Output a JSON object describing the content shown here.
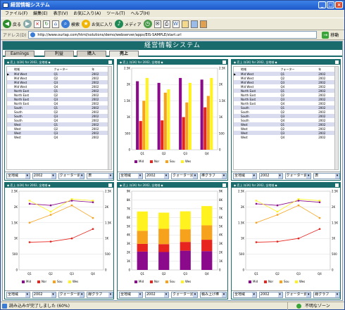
{
  "window": {
    "title": "経営情報システム"
  },
  "menu": [
    "ファイル(F)",
    "編集(E)",
    "表示(V)",
    "お気に入り(A)",
    "ツール(T)",
    "ヘルプ(H)"
  ],
  "toolbar": {
    "back": "戻る",
    "search": "検索",
    "favorites": "お気に入り",
    "media": "メディア"
  },
  "address": {
    "label": "アドレス(D)",
    "url": "http://www.ourlap.com/html/solutions/demo/webserver/apps/EIS-SAMPLE/start.url",
    "go": "移動"
  },
  "app": {
    "title": "経営情報システム",
    "tabs": [
      "Earnings",
      "利益",
      "購入",
      "売上"
    ],
    "active_tab": 3
  },
  "panel_header": "◆ 売上 ($1K) for 2002, 全地域 ◆",
  "table": {
    "columns": [
      "地域",
      "クォーター",
      "年"
    ],
    "rows": [
      [
        "Mid West",
        "Q1",
        "2002"
      ],
      [
        "Mid West",
        "Q2",
        "2002"
      ],
      [
        "Mid West",
        "Q3",
        "2002"
      ],
      [
        "Mid West",
        "Q4",
        "2002"
      ],
      [
        "North East",
        "Q1",
        "2002"
      ],
      [
        "North East",
        "Q2",
        "2002"
      ],
      [
        "North East",
        "Q3",
        "2002"
      ],
      [
        "North East",
        "Q4",
        "2002"
      ],
      [
        "South",
        "Q1",
        "2002"
      ],
      [
        "South",
        "Q2",
        "2002"
      ],
      [
        "South",
        "Q3",
        "2002"
      ],
      [
        "South",
        "Q4",
        "2002"
      ],
      [
        "West",
        "Q1",
        "2002"
      ],
      [
        "West",
        "Q2",
        "2002"
      ],
      [
        "West",
        "Q3",
        "2002"
      ],
      [
        "West",
        "Q4",
        "2002"
      ]
    ]
  },
  "controls": {
    "region": "全地域",
    "year": "2002",
    "quarter": "クォーター別",
    "view_table": "表",
    "view_bar": "棒グラフ",
    "view_line": "線グラフ",
    "view_stacked": "積み上げ棒"
  },
  "status": {
    "left": "読み込みが完了しました (60%)",
    "right": "不明なゾーン"
  },
  "colors": {
    "Mid": "#8B0A8B",
    "Nor": "#E8241E",
    "Sou": "#F7A21C",
    "Wes": "#FFF21E"
  },
  "chart_data": [
    {
      "type": "bar",
      "categories": [
        "Q1",
        "Q2",
        "Q3",
        "Q4"
      ],
      "series": [
        {
          "name": "Mid",
          "values": [
            2100,
            2050,
            2200,
            2150
          ]
        },
        {
          "name": "Nor",
          "values": [
            880,
            900,
            1000,
            1300
          ]
        },
        {
          "name": "Sou",
          "values": [
            1500,
            1750,
            1450,
            1650
          ]
        },
        {
          "name": "Wes",
          "values": [
            2200,
            1850,
            2050,
            2200
          ]
        }
      ],
      "ylim": [
        0,
        2500
      ],
      "yticks": [
        "0",
        "500",
        "1K",
        "1.5K",
        "2K",
        "2.5K"
      ],
      "legend": "bottom"
    },
    {
      "type": "line",
      "categories": [
        "Q1",
        "Q2",
        "Q3",
        "Q4"
      ],
      "series": [
        {
          "name": "Mid",
          "values": [
            2100,
            2050,
            2200,
            2150
          ]
        },
        {
          "name": "Nor",
          "values": [
            880,
            900,
            1000,
            1300
          ]
        },
        {
          "name": "Sou",
          "values": [
            1500,
            1750,
            2050,
            1650
          ]
        },
        {
          "name": "Wes",
          "values": [
            2200,
            1850,
            2250,
            2200
          ]
        }
      ],
      "ylim": [
        0,
        2500
      ],
      "yticks": [
        "0",
        "500",
        "1K",
        "1.5K",
        "2K",
        "2.5K"
      ],
      "legend": "bottom"
    },
    {
      "type": "bar",
      "stacked": true,
      "categories": [
        "Q1",
        "Q2",
        "Q3",
        "Q4"
      ],
      "series": [
        {
          "name": "Mid",
          "values": [
            2100,
            2050,
            2200,
            2150
          ]
        },
        {
          "name": "Nor",
          "values": [
            880,
            900,
            1000,
            1300
          ]
        },
        {
          "name": "Sou",
          "values": [
            1500,
            1750,
            1450,
            1650
          ]
        },
        {
          "name": "Wes",
          "values": [
            2200,
            1850,
            2050,
            2200
          ]
        }
      ],
      "ylim": [
        0,
        9000
      ],
      "yticks": [
        "0",
        "1K",
        "2K",
        "3K",
        "4K",
        "5K",
        "6K",
        "7K",
        "8K",
        "9K"
      ],
      "legend": "bottom"
    },
    {
      "type": "line",
      "categories": [
        "Q1",
        "Q2",
        "Q3",
        "Q4"
      ],
      "series": [
        {
          "name": "Mid",
          "values": [
            2100,
            2050,
            2200,
            2150
          ]
        },
        {
          "name": "Nor",
          "values": [
            880,
            900,
            1000,
            1300
          ]
        },
        {
          "name": "Sou",
          "values": [
            1500,
            1750,
            2050,
            1650
          ]
        },
        {
          "name": "Wes",
          "values": [
            2200,
            1850,
            2250,
            2200
          ]
        }
      ],
      "ylim": [
        0,
        2500
      ],
      "yticks": [
        "0",
        "500",
        "1K",
        "1.5K",
        "2K",
        "2.5K"
      ],
      "legend": "bottom"
    }
  ]
}
